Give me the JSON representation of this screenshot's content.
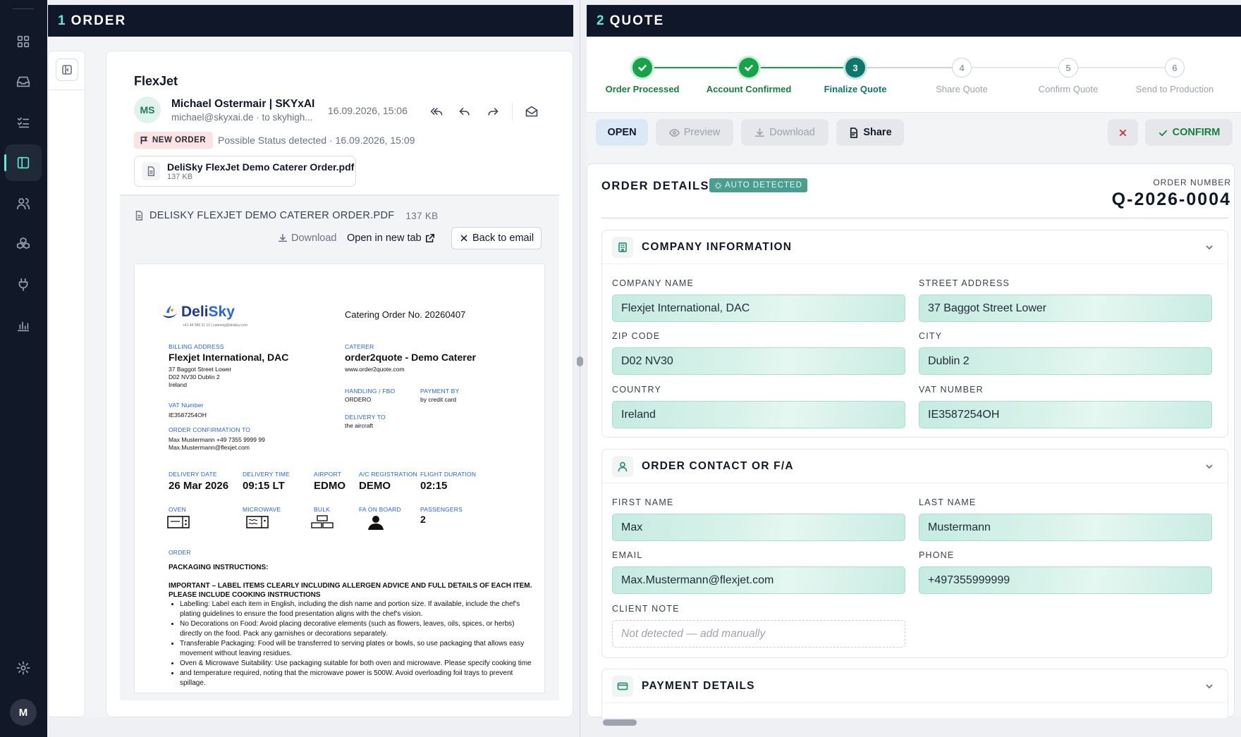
{
  "order_panel": {
    "number": "1",
    "title": "ORDER"
  },
  "quote_panel": {
    "number": "2",
    "title": "QUOTE"
  },
  "email": {
    "subject": "FlexJet",
    "avatar_initials": "MS",
    "sender_name": "Michael Ostermair | SKYxAI",
    "sender_sub": "michael@skyxai.de · to skyhigh...",
    "date": "16.09.2026, 15:06",
    "badge": "NEW ORDER",
    "status": "Possible Status detected · 16.09.2026, 15:09",
    "attachment": {
      "name": "DeliSky FlexJet Demo Caterer Order.pdf",
      "size": "137 KB"
    }
  },
  "viewer": {
    "title": "DELISKY FLEXJET DEMO CATERER ORDER.PDF",
    "size": "137 KB",
    "download": "Download",
    "open_new_tab": "Open in new tab",
    "back": "Back to email"
  },
  "pdf": {
    "logo_deli": "Deli",
    "logo_sky": "Sky",
    "logo_contact": "+41 44 586 31 10 | catering@delisky.com",
    "order_no": "Catering Order No. 20260407",
    "billing_label": "BILLING ADDRESS",
    "billing_name": "Flexjet International, DAC",
    "billing_lines": [
      "37 Baggot Street Lower",
      "D02 NV30 Dublin 2",
      "Ireland"
    ],
    "vat_label": "VAT Number",
    "vat": "IE3587254OH",
    "confirm_label": "ORDER CONFIRMATION TO",
    "confirm_lines": [
      "Max Mustermann  +49 7355 9999 99",
      "Max.Mustermann@flexjet.com"
    ],
    "caterer_label": "CATERER",
    "caterer_name": "order2quote - Demo Caterer",
    "caterer_web": "www.order2quote.com",
    "handling_label": "HANDLING / FBO",
    "handling": "ORDERO",
    "payment_label": "PAYMENT BY",
    "payment": "by credit card",
    "delivery_to_label": "DELIVERY TO",
    "delivery_to": "the aircraft",
    "delivery_date_label": "DELIVERY DATE",
    "delivery_date": "26 Mar 2026",
    "delivery_time_label": "DELIVERY TIME",
    "delivery_time": "09:15 LT",
    "airport_label": "AIRPORT",
    "airport": "EDMO",
    "reg_label": "A/C REGISTRATION",
    "reg": "DEMO",
    "duration_label": "FLIGHT DURATION",
    "duration": "02:15",
    "oven_label": "OVEN",
    "microwave_label": "MICROWAVE",
    "bulk_label": "BULK",
    "fa_label": "FA ON BOARD",
    "pax_label": "PASSENGERS",
    "pax": "2",
    "order_label": "ORDER",
    "pack_title": "PACKAGING INSTRUCTIONS:",
    "important_1": "IMPORTANT – LABEL ITEMS CLEARLY INCLUDING ALLERGEN ADVICE AND FULL DETAILS OF EACH ITEM.",
    "important_2": "PLEASE INCLUDE COOKING INSTRUCTIONS",
    "bullets": [
      "Labelling: Label each item in English, including the dish name and portion size. If available, include the chef's plating guidelines to ensure the food presentation aligns with the chef's vision.",
      "No Decorations on Food: Avoid placing decorative elements (such as flowers, leaves, oils, spices, or herbs) directly on the food. Pack any garnishes or decorations separately.",
      "Transferable Packaging: Food will be transferred to serving plates or bowls, so use packaging that allows easy movement without leaving residues.",
      "Oven & Microwave Suitability: Use packaging suitable for both oven and microwave. Please specify cooking time",
      "and temperature required, noting that the microwave power is 500W. Avoid overloading foil trays to prevent spillage."
    ]
  },
  "steps": [
    {
      "label": "Order Processed",
      "state": "done",
      "num": "1"
    },
    {
      "label": "Account Confirmed",
      "state": "done",
      "num": "2"
    },
    {
      "label": "Finalize Quote",
      "state": "current",
      "num": "3"
    },
    {
      "label": "Share Quote",
      "state": "todo",
      "num": "4"
    },
    {
      "label": "Confirm Quote",
      "state": "todo",
      "num": "5"
    },
    {
      "label": "Send to Production",
      "state": "todo",
      "num": "6"
    }
  ],
  "actions": {
    "open": "OPEN",
    "preview": "Preview",
    "download": "Download",
    "share": "Share",
    "confirm": "CONFIRM"
  },
  "details": {
    "title": "ORDER DETAILS",
    "auto": "AUTO DETECTED",
    "order_number_label": "ORDER NUMBER",
    "order_number": "Q-2026-0004",
    "company": {
      "title": "COMPANY INFORMATION",
      "company_name_label": "COMPANY NAME",
      "company_name": "Flexjet International, DAC",
      "street_label": "STREET ADDRESS",
      "street": "37 Baggot Street Lower",
      "zip_label": "ZIP CODE",
      "zip": "D02 NV30",
      "city_label": "CITY",
      "city": "Dublin 2",
      "country_label": "COUNTRY",
      "country": "Ireland",
      "vat_label": "VAT NUMBER",
      "vat": "IE3587254OH"
    },
    "contact": {
      "title": "ORDER CONTACT OR F/A",
      "first_label": "FIRST NAME",
      "first": "Max",
      "last_label": "LAST NAME",
      "last": "Mustermann",
      "email_label": "EMAIL",
      "email": "Max.Mustermann@flexjet.com",
      "phone_label": "PHONE",
      "phone": "+497355999999",
      "note_label": "CLIENT NOTE",
      "note_placeholder": "Not detected — add manually"
    },
    "payment": {
      "title": "PAYMENT DETAILS"
    }
  },
  "user": {
    "initial": "M"
  }
}
